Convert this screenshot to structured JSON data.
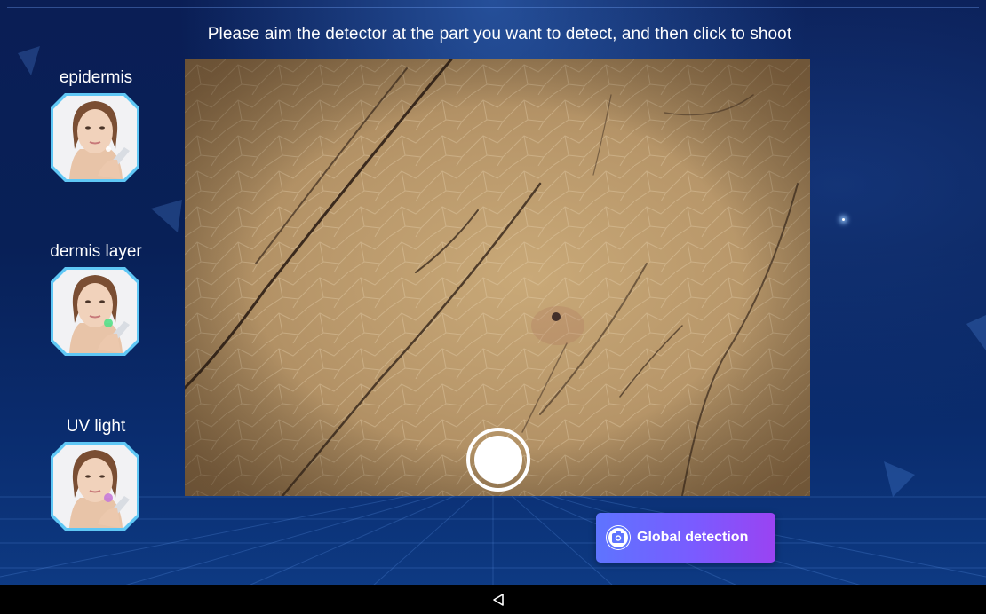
{
  "screen": {
    "instruction": "Please aim the detector at the part you want to detect, and then click to shoot"
  },
  "modes": [
    {
      "label": "epidermis",
      "light_color": "#ffffff"
    },
    {
      "label": "dermis layer",
      "light_color": "#55e08a"
    },
    {
      "label": "UV light",
      "light_color": "#c77ad8"
    }
  ],
  "actions": {
    "global_detection_label": "Global detection"
  },
  "colors": {
    "accent_start": "#5e74ff",
    "accent_end": "#9a43f2",
    "tile_border": "#5fc7f5"
  },
  "icons": {
    "shutter": "shutter-icon",
    "camera": "camera-icon",
    "nav_back": "nav-back-icon"
  }
}
